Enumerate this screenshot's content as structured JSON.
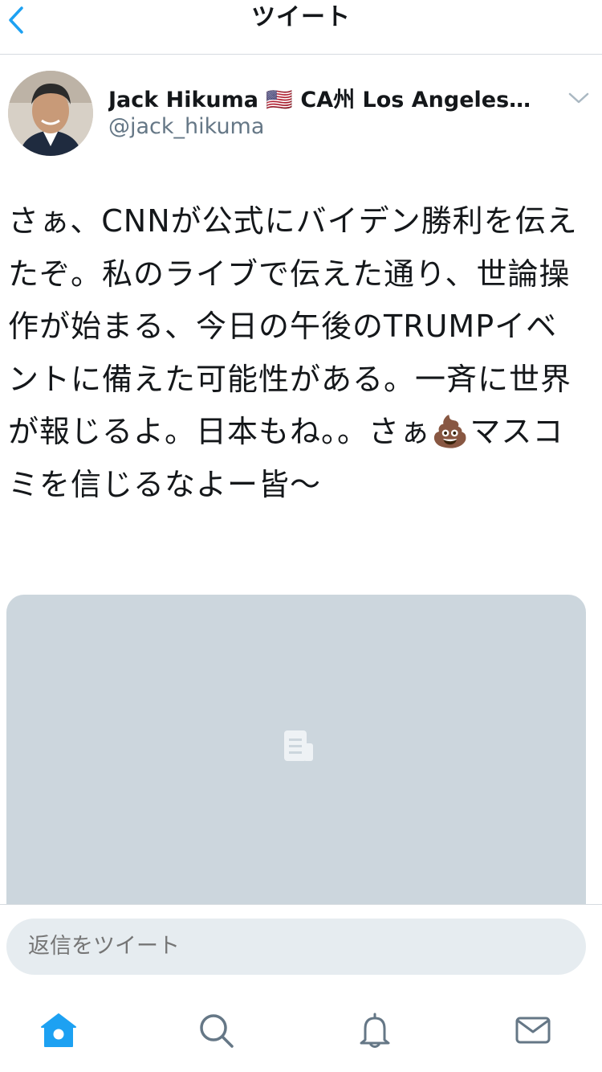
{
  "header": {
    "title": "ツイート",
    "back_icon": "chevron-left-icon"
  },
  "tweet": {
    "author_name": "Jack Hikuma 🇺🇸 CA州 Los Angeles…",
    "author_handle": "@jack_hikuma",
    "text": "さぁ、CNNが公式にバイデン勝利を伝えたぞ。私のライブで伝えた通り、世論操作が始まる、今日の午後のTRUMPイベントに備えた可能性がある。一斉に世界が報じるよ。日本もね。。さぁ💩マスコミを信じるなよー皆〜",
    "media_icon": "document-icon"
  },
  "reply": {
    "placeholder": "返信をツイート"
  },
  "tabs": [
    {
      "name": "home",
      "icon": "home-icon",
      "active": true
    },
    {
      "name": "search",
      "icon": "search-icon",
      "active": false
    },
    {
      "name": "notifications",
      "icon": "bell-icon",
      "active": false
    },
    {
      "name": "messages",
      "icon": "envelope-icon",
      "active": false
    }
  ],
  "colors": {
    "accent": "#1da1f2",
    "icon_gray": "#657786",
    "card_bg": "#ccd6dd",
    "input_bg": "#e6ecf0"
  }
}
